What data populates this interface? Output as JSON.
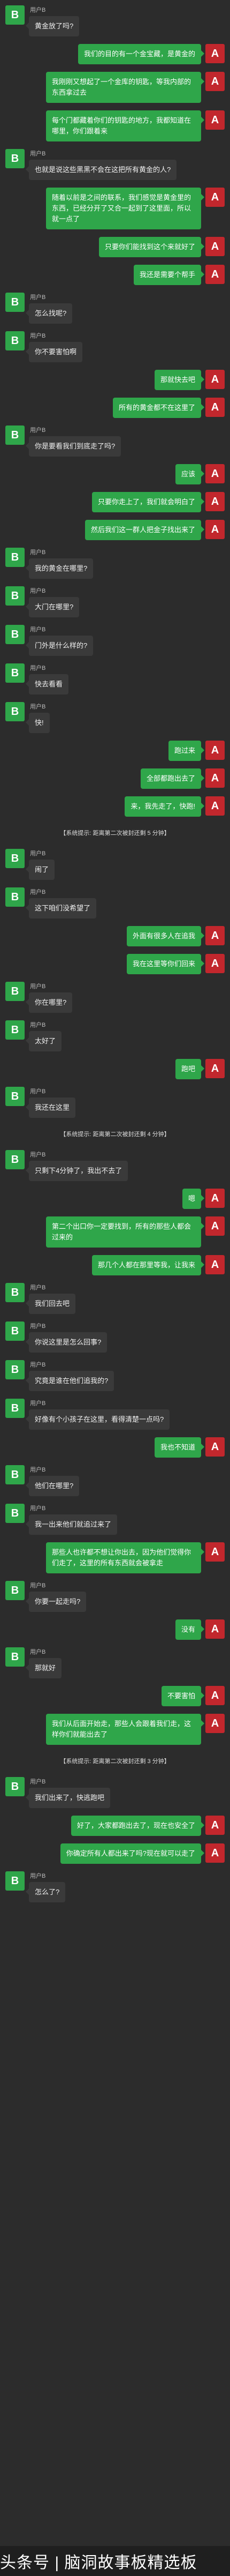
{
  "users": {
    "b": {
      "avatar": "B",
      "name": "用户B"
    },
    "a": {
      "avatar": "A"
    }
  },
  "messages": [
    {
      "type": "b",
      "text": "黄金放了吗?"
    },
    {
      "type": "a",
      "text": "我们的目的有一个金宝藏，是黄金的"
    },
    {
      "type": "a",
      "text": "我刚刚又想起了一个金库的钥匙，等我内部的东西拿过去"
    },
    {
      "type": "a",
      "text": "每个门都藏着你们的钥匙的地方，我都知道在哪里，你们跟着来"
    },
    {
      "type": "b",
      "text": "也就是说这些黑黑不会在这把所有黄金的人?"
    },
    {
      "type": "a",
      "text": "随着以前是之间的联系，我们感觉是黄金里的东西，已经分开了又合一起到了这里面，所以就一点了"
    },
    {
      "type": "a",
      "text": "只要你们能找到这个来就好了"
    },
    {
      "type": "a",
      "text": "我还是需要个帮手"
    },
    {
      "type": "b",
      "text": "怎么找呢?"
    },
    {
      "type": "b",
      "text": "你不要害怕啊"
    },
    {
      "type": "a",
      "text": "那就快去吧"
    },
    {
      "type": "a",
      "text": "所有的黄金都不在这里了"
    },
    {
      "type": "b",
      "text": "你是要看我们到底走了吗?"
    },
    {
      "type": "a",
      "text": "应该"
    },
    {
      "type": "a",
      "text": "只要你走上了，我们就会明白了"
    },
    {
      "type": "a",
      "text": "然后我们这一群人把金子找出来了"
    },
    {
      "type": "b",
      "text": "我的黄金在哪里?"
    },
    {
      "type": "b",
      "text": "大门在哪里?"
    },
    {
      "type": "b",
      "text": "门外是什么样的?"
    },
    {
      "type": "b",
      "text": "快去看看"
    },
    {
      "type": "b",
      "text": "快!"
    },
    {
      "type": "a",
      "text": "跑过来"
    },
    {
      "type": "a",
      "text": "全部都跑出去了"
    },
    {
      "type": "a",
      "text": "来，我先走了，快跑!"
    },
    {
      "type": "sys",
      "text": "【系统提示: 距离第二次被封还剩 5 分钟】"
    },
    {
      "type": "b",
      "text": "闹了"
    },
    {
      "type": "b",
      "text": "这下咱们没希望了"
    },
    {
      "type": "a",
      "text": "外面有很多人在追我"
    },
    {
      "type": "a",
      "text": "我在这里等你们回来"
    },
    {
      "type": "b",
      "text": "你在哪里?"
    },
    {
      "type": "b",
      "text": "太好了"
    },
    {
      "type": "a",
      "text": "跑吧"
    },
    {
      "type": "b",
      "text": "我还在这里"
    },
    {
      "type": "sys",
      "text": "【系统提示: 距离第二次被封还剩 4 分钟】"
    },
    {
      "type": "b",
      "text": "只剩下4分钟了，我出不去了"
    },
    {
      "type": "a",
      "text": "嗯"
    },
    {
      "type": "a",
      "text": "第二个出口你一定要找到，所有的那些人都会过来的"
    },
    {
      "type": "a",
      "text": "那几个人都在那里等我，让我来"
    },
    {
      "type": "b",
      "text": "我们回去吧"
    },
    {
      "type": "b",
      "text": "你说这里是怎么回事?"
    },
    {
      "type": "b",
      "text": "究竟是谁在他们追我的?"
    },
    {
      "type": "b",
      "text": "好像有个小孩子在这里，看得清楚一点吗?"
    },
    {
      "type": "a",
      "text": "我也不知道"
    },
    {
      "type": "b",
      "text": "他们在哪里?"
    },
    {
      "type": "b",
      "text": "我一出来他们就追过来了"
    },
    {
      "type": "a",
      "text": "那些人也许都不想让你出去，因为他们觉得你们走了，这里的所有东西就会被拿走"
    },
    {
      "type": "b",
      "text": "你要一起走吗?"
    },
    {
      "type": "a",
      "text": "没有"
    },
    {
      "type": "b",
      "text": "那就好"
    },
    {
      "type": "a",
      "text": "不要害怕"
    },
    {
      "type": "a",
      "text": "我们从后面开始走，那些人会跟着我们走，这样你们就能出去了"
    },
    {
      "type": "sys",
      "text": "【系统提示: 距离第二次被封还剩 3 分钟】"
    },
    {
      "type": "b",
      "text": "我们出来了，快逃跑吧"
    },
    {
      "type": "a",
      "text": "好了，大家都跑出去了，现在也安全了"
    },
    {
      "type": "a",
      "text": "你确定所有人都出来了吗?现在就可以走了"
    },
    {
      "type": "b",
      "text": "怎么了?"
    }
  ],
  "footer": {
    "text": "头条号 | 脑洞故事板精选板"
  }
}
